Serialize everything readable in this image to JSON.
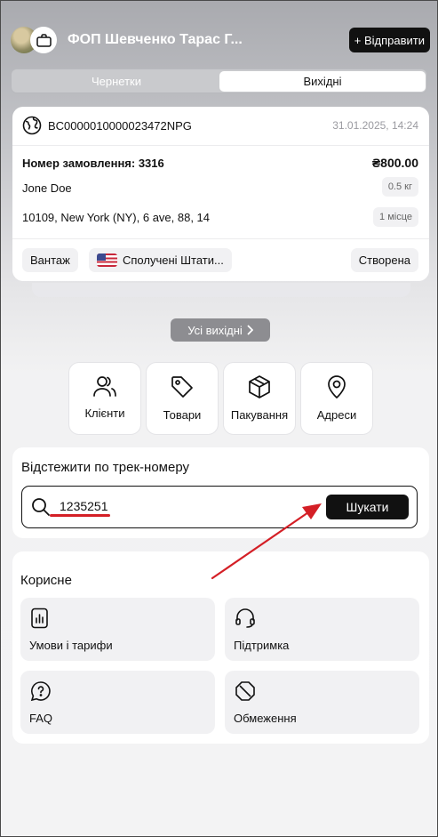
{
  "header": {
    "shop_name": "ФОП Шевченко Тарас Г...",
    "send_label": "+ Відправити"
  },
  "tabs": [
    {
      "label": "Чернетки",
      "active": false
    },
    {
      "label": "Вихідні",
      "active": true
    }
  ],
  "shipment": {
    "tracking": "BC0000010000023472NPG",
    "date": "31.01.2025, 14:24",
    "order_label": "Номер замовлення: 3316",
    "price": "₴800.00",
    "recipient": "Jone Doe",
    "weight": "0.5 кг",
    "address": "10109, New York (NY), 6 ave, 88, 14",
    "places": "1 місце",
    "type": "Вантаж",
    "country": "Сполучені Штати...",
    "status": "Створена"
  },
  "all_outgoing_label": "Усі вихідні",
  "quick_actions": [
    {
      "label": "Клієнти",
      "icon": "users-icon"
    },
    {
      "label": "Товари",
      "icon": "tag-icon"
    },
    {
      "label": "Пакування",
      "icon": "box-icon"
    },
    {
      "label": "Адреси",
      "icon": "map-pin-icon"
    }
  ],
  "track_search": {
    "title": "Відстежити по трек-номеру",
    "value": "1235251",
    "button": "Шукати"
  },
  "useful": {
    "title": "Корисне",
    "items": [
      {
        "label": "Умови і тарифи",
        "icon": "chart-doc-icon"
      },
      {
        "label": "Підтримка",
        "icon": "headset-icon"
      },
      {
        "label": "FAQ",
        "icon": "question-bubble-icon"
      },
      {
        "label": "Обмеження",
        "icon": "no-entry-icon"
      }
    ]
  },
  "colors": {
    "accent": "#111111",
    "annotation": "#d41f26",
    "muted": "#9a9aa0"
  }
}
